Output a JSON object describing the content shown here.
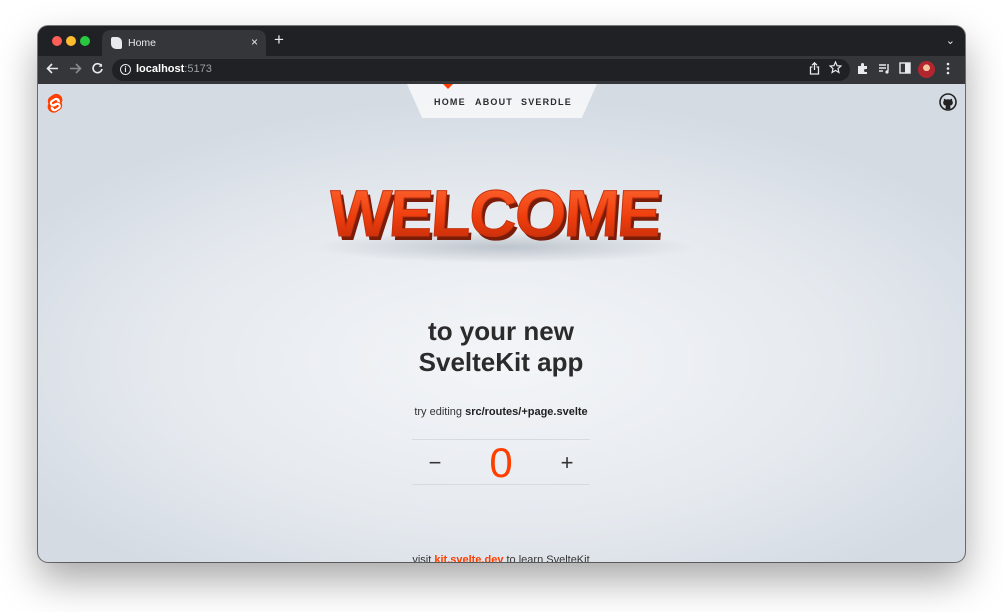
{
  "browser": {
    "tab_title": "Home",
    "tab_close": "×",
    "new_tab": "+",
    "tab_menu": "⌄",
    "url_host": "localhost",
    "url_port": ":5173",
    "icons": [
      "back-arrow-icon",
      "forward-arrow-icon",
      "reload-icon",
      "site-info-icon",
      "share-icon",
      "star-icon",
      "extensions-icon",
      "media-icon",
      "sidepanel-icon",
      "profile-avatar",
      "menu-icon"
    ]
  },
  "nav": {
    "home": "HOME",
    "about": "ABOUT",
    "sverdle": "SVERDLE",
    "active": "home"
  },
  "hero": {
    "welcome_text": "WELCOME",
    "tagline_line1": "to your new",
    "tagline_line2": "SvelteKit app"
  },
  "hint": {
    "prefix": "try editing ",
    "path": "src/routes/+page.svelte"
  },
  "counter": {
    "minus": "−",
    "value": "0",
    "plus": "+"
  },
  "footer": {
    "prefix": "visit ",
    "link": "kit.svelte.dev",
    "suffix": " to learn SvelteKit"
  },
  "colors": {
    "accent": "#ff3e00",
    "text": "#2b2b2b",
    "chrome_dark": "#202124",
    "chrome_toolbar": "#35363a"
  }
}
